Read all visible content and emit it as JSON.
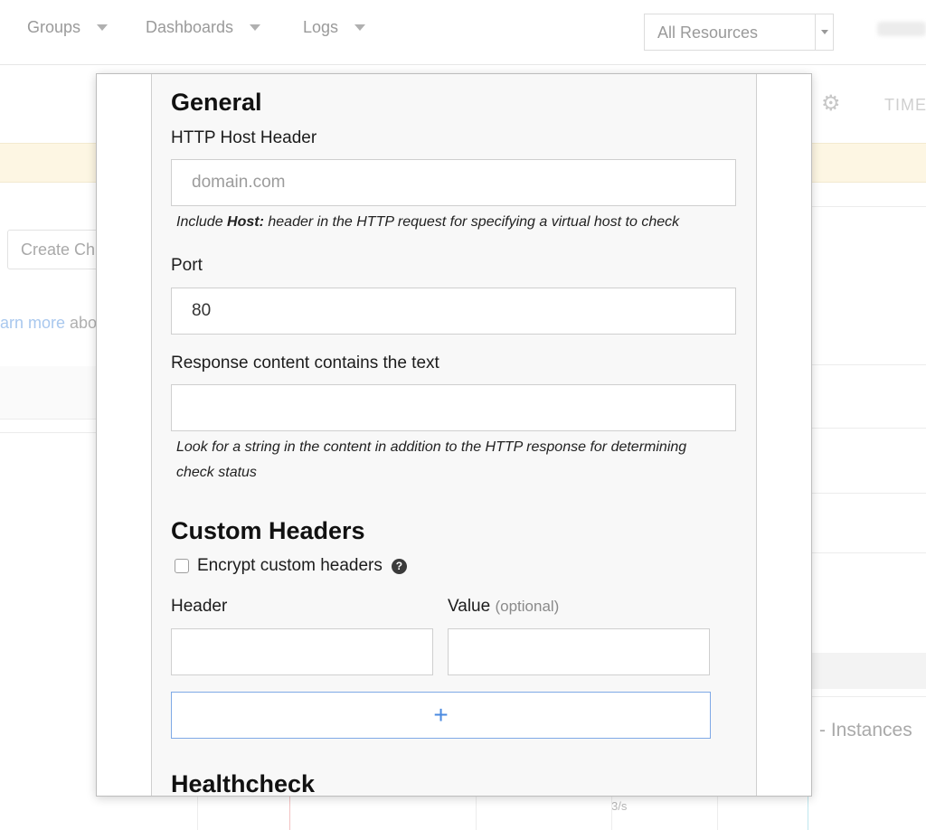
{
  "nav": {
    "items": [
      "Groups",
      "Dashboards",
      "Logs"
    ],
    "resource_select": "All Resources"
  },
  "background": {
    "time_label": "TIME",
    "create_button": "Create Ch",
    "learn_more_link": "arn more",
    "learn_more_rest": " abo",
    "instances_label": "- Instances",
    "rate_label": "3/s"
  },
  "modal": {
    "general": {
      "title": "General",
      "host_header": {
        "label": "HTTP Host Header",
        "placeholder": "domain.com",
        "value": "",
        "help_prefix": "Include ",
        "help_bold": "Host:",
        "help_suffix": " header in the HTTP request for specifying a virtual host to check"
      },
      "port": {
        "label": "Port",
        "value": "80"
      },
      "response_content": {
        "label": "Response content contains the text",
        "value": "",
        "help": "Look for a string in the content in addition to the HTTP response for determining check status"
      }
    },
    "custom_headers": {
      "title": "Custom Headers",
      "encrypt_label": "Encrypt custom headers",
      "encrypt_checked": false,
      "header_col_label": "Header",
      "value_col_label": "Value",
      "value_col_optional": "(optional)",
      "header_value": "",
      "value_value": "",
      "add_button": "+"
    },
    "healthcheck": {
      "title": "Healthcheck"
    }
  },
  "colors": {
    "accent": "#4a8ae0",
    "banner": "#fdf6e3"
  }
}
